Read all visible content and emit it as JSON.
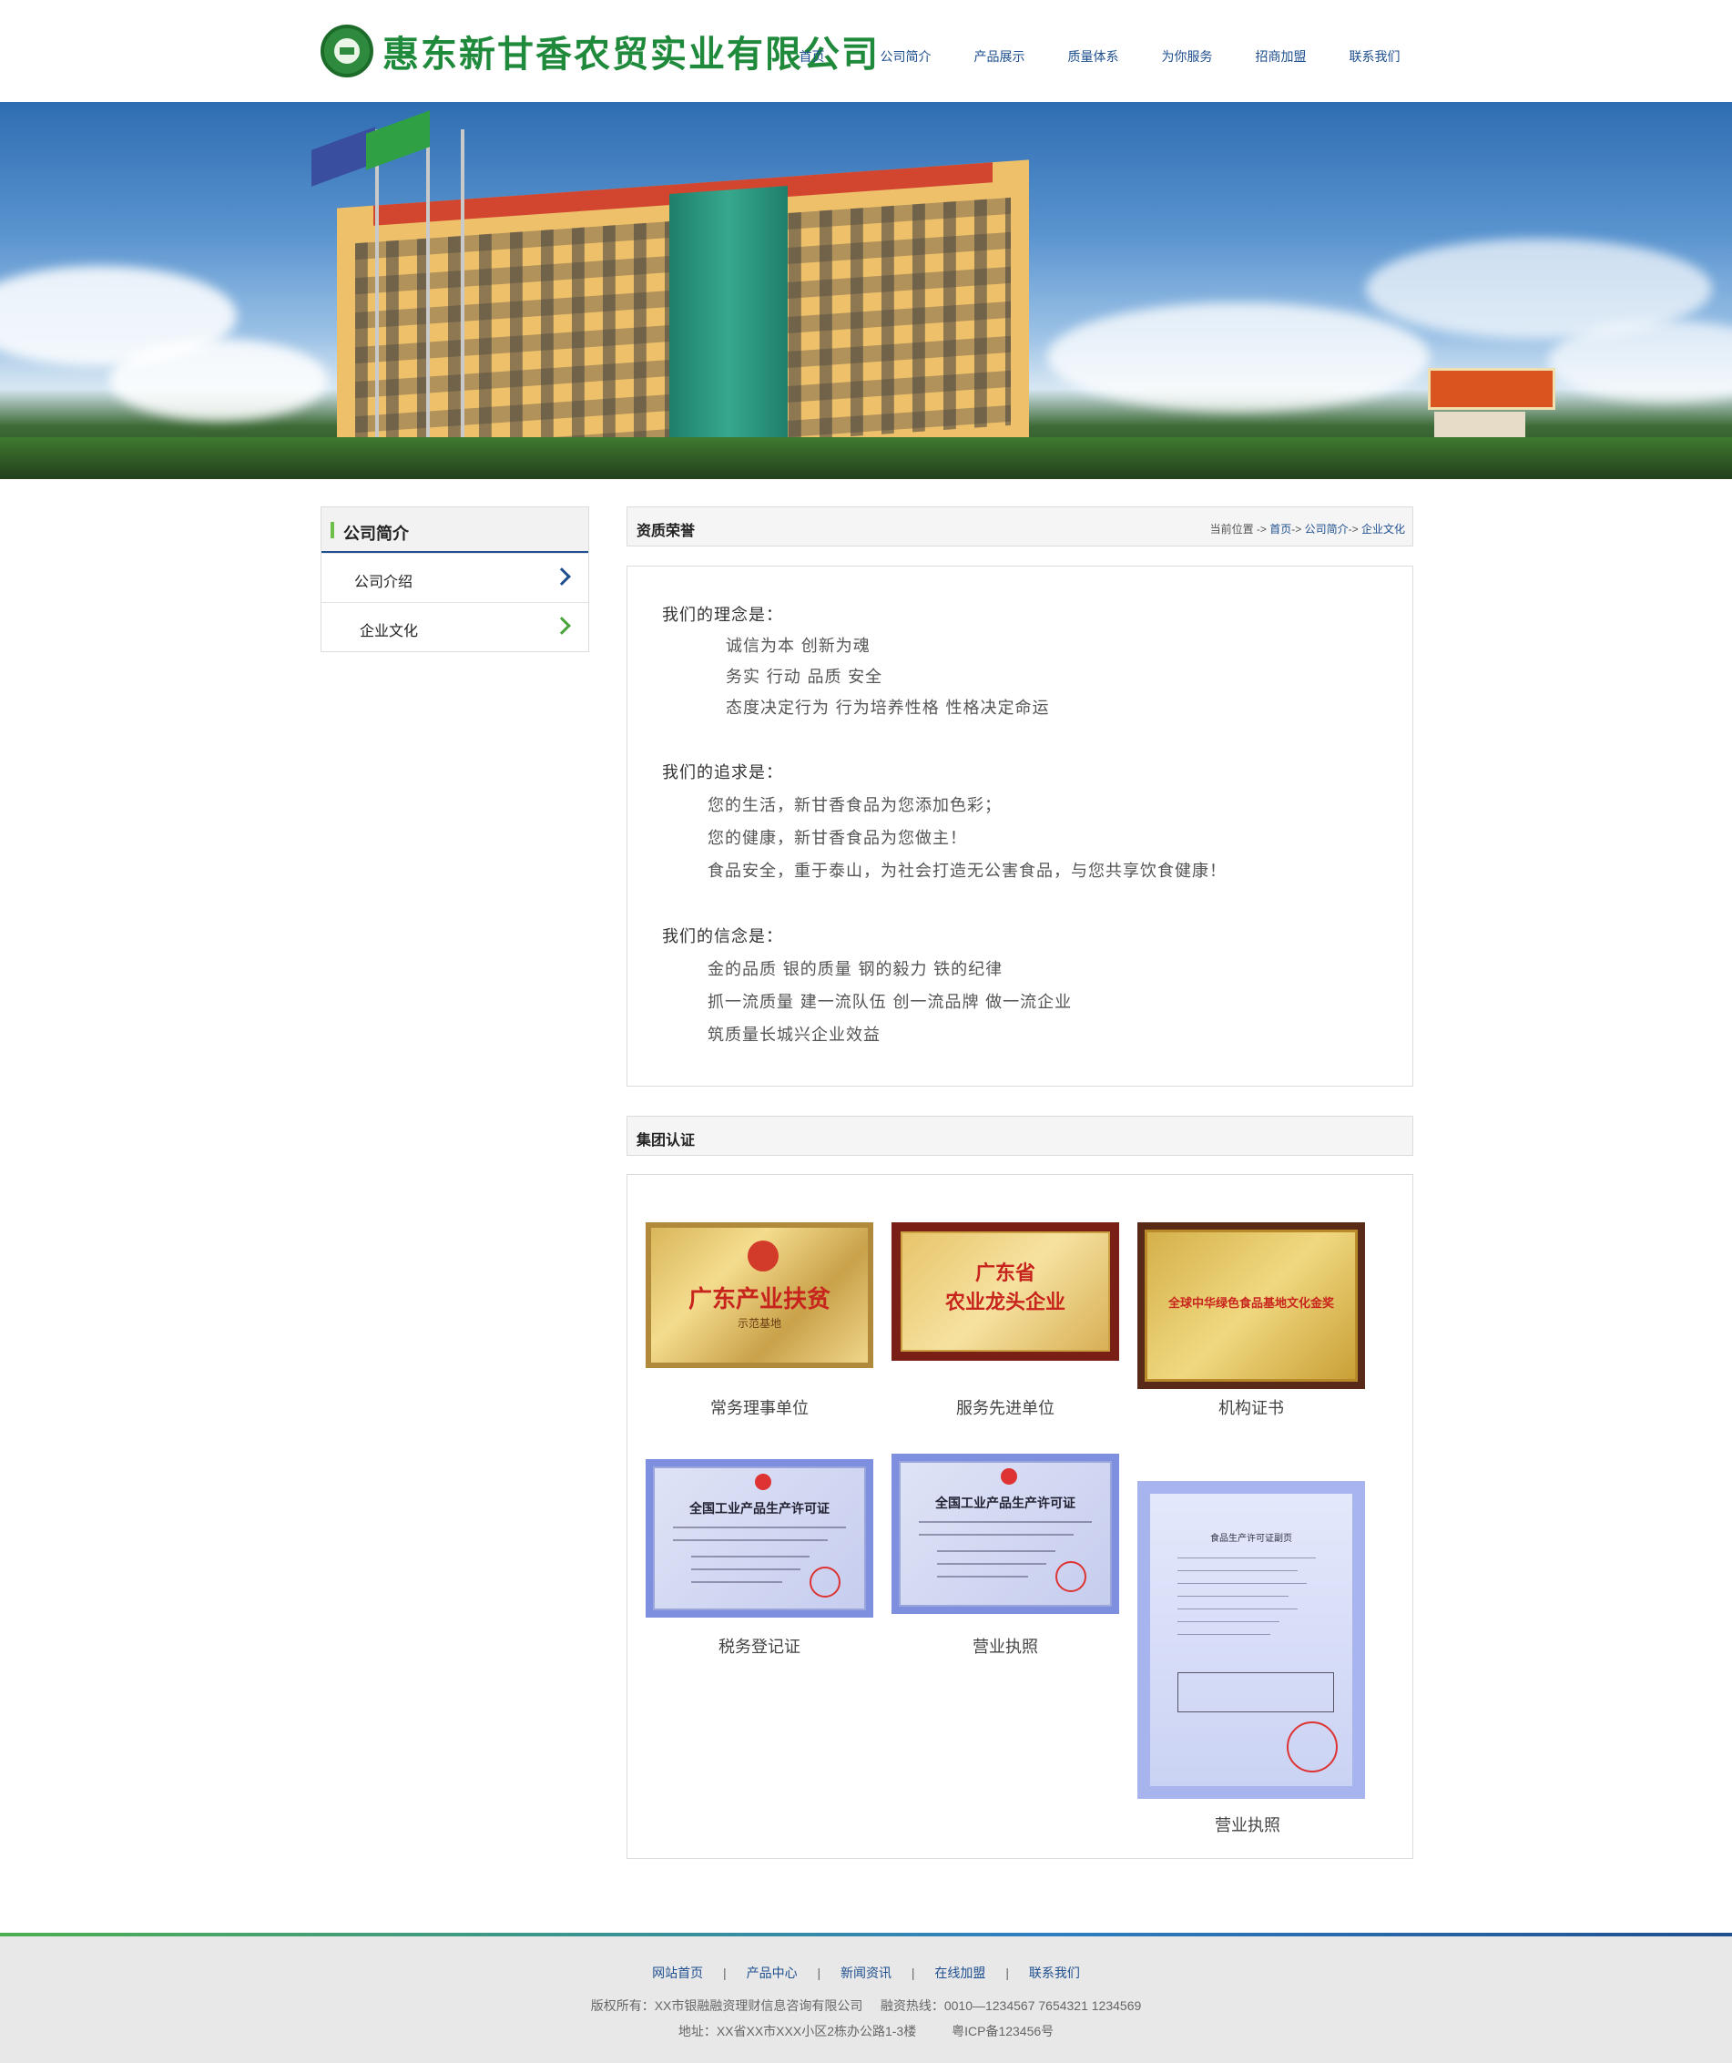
{
  "header": {
    "logo_text": "惠东新甘香农贸实业有限公司",
    "nav": [
      "首页",
      "公司简介",
      "产品展示",
      "质量体系",
      "为你服务",
      "招商加盟",
      "联系我们"
    ]
  },
  "sidebar": {
    "title": "公司简介",
    "items": [
      "公司介绍",
      "企业文化"
    ]
  },
  "section1": {
    "title": "资质荣誉",
    "breadcrumb": {
      "prefix": "当前位置 -> ",
      "home": "首页",
      "sep1": "-> ",
      "level1": "公司简介",
      "sep2": "-> ",
      "level2": "企业文化"
    },
    "philosophy_heading": "我们的理念是：",
    "philosophy_lines": [
      "诚信为本 创新为魂",
      "务实 行动 品质 安全",
      "态度决定行为 行为培养性格 性格决定命运"
    ],
    "pursuit_heading": "我们的追求是：",
    "pursuit_lines": [
      "您的生活，新甘香食品为您添加色彩；",
      "您的健康，新甘香食品为您做主！",
      "食品安全，重于泰山，为社会打造无公害食品，与您共享饮食健康！"
    ],
    "belief_heading": "我们的信念是：",
    "belief_lines": [
      "金的品质 银的质量 钢的毅力 铁的纪律",
      "抓一流质量 建一流队伍 创一流品牌 做一流企业",
      "筑质量长城兴企业效益"
    ]
  },
  "section2": {
    "title": "集团认证",
    "certs": [
      {
        "caption": "常务理事单位",
        "plaque_text": "广东产业扶贫",
        "plaque_sub": "示范基地"
      },
      {
        "caption": "服务先进单位",
        "plaque_text_1": "广东省",
        "plaque_text_2": "农业龙头企业"
      },
      {
        "caption": "机构证书",
        "plaque_text": "全球中华绿色食品基地文化金奖"
      },
      {
        "caption": "税务登记证",
        "plaque_text": "全国工业产品生产许可证"
      },
      {
        "caption": "营业执照",
        "plaque_text": "全国工业产品生产许可证"
      },
      {
        "caption": "营业执照",
        "plaque_text": "食品生产许可证副页"
      }
    ]
  },
  "footer": {
    "nav": [
      "网站首页",
      "产品中心",
      "新闻资讯",
      "在线加盟",
      "联系我们"
    ],
    "separator": "|",
    "copyright": "版权所有：XX市银融融资理财信息咨询有限公司     融资热线：0010—1234567 7654321 1234569",
    "address": "地址：XX省XX市XXX小区2栋办公路1-3楼          粤ICP备123456号"
  },
  "colors": {
    "brand_green": "#1f8a3b",
    "nav_blue": "#1f4f8f",
    "accent_green": "#6cc04a"
  }
}
